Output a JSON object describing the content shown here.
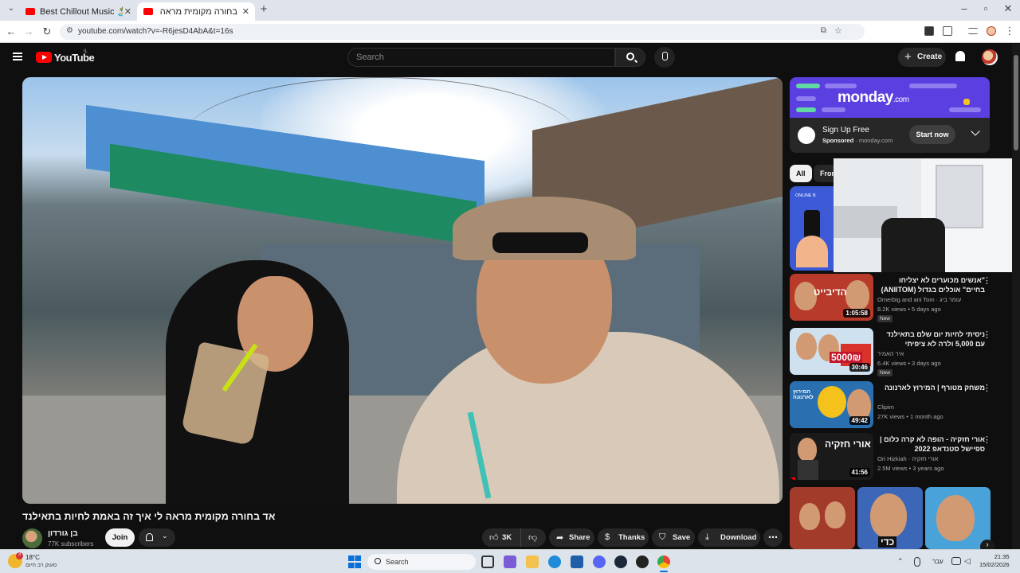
{
  "browser": {
    "tabs": [
      {
        "title": "Best Chillout Music 🏝️ LOUNGE",
        "active": false
      },
      {
        "title": "בחורה מקומית מראה לי איך",
        "active": true
      }
    ],
    "url": "youtube.com/watch?v=-R6jesD4AbA&t=16s"
  },
  "header": {
    "logo": "YouTube",
    "country_code": "IL",
    "search_placeholder": "Search",
    "create_label": "Create"
  },
  "video": {
    "title": "אד בחורה מקומית מראה לי איך זה באמת לחיות בתאילנד",
    "channel_name": "בן גורדון",
    "subscribers": "77K subscribers",
    "join_label": "Join",
    "likes": "3K",
    "share_label": "Share",
    "thanks_label": "Thanks",
    "save_label": "Save",
    "download_label": "Download"
  },
  "ad": {
    "brand": "monday",
    "brand_suffix": ".com",
    "title": "Sign Up Free",
    "sponsored": "Sponsored",
    "domain": "monday.com",
    "cta": "Start now"
  },
  "chips": {
    "all": "All",
    "from": "From"
  },
  "partial_thumb_label": "ONLINE B",
  "recommendations": [
    {
      "title": "\"אנשים מכוערים לא יצליחו בחיים\" אוכלים בגדול (ANIITOM)",
      "channel": "Omerbig and ani Tom · עומר ביג",
      "views": "8.2K views • 5 days ago",
      "badge": "New",
      "duration": "1:05:58",
      "thumb_text": "הדיבייט",
      "thumb_color": "#b83a2a",
      "progress": 0
    },
    {
      "title": "ניסיתי לחיות יום שלם בתאילנד עם 5,000 ולרה לא ציפיתי",
      "channel": "איר האמיר",
      "views": "6.4K views • 3 days ago",
      "badge": "New",
      "duration": "30:46",
      "thumb_text": "5000₪",
      "thumb_color": "#cfe0ef",
      "progress": 0
    },
    {
      "title": "משחק מטורף | המירוץ לארנונה",
      "channel": "Clipim",
      "views": "27K views • 1 month ago",
      "badge": "",
      "duration": "49:42",
      "thumb_text": "המירוץ לארנונה",
      "thumb_color": "#2a6fb0",
      "progress": 0
    },
    {
      "title": "אורי חזקיה - הופה לא קרה כלום | ספיישל סטנדאפ 2022",
      "channel": "Ori Hizkiah · אורי חזקיה",
      "views": "2.5M views • 3 years ago",
      "badge": "",
      "duration": "41:56",
      "thumb_text": "אורי חזקיה",
      "thumb_color": "#1a1a1a",
      "progress": 0.07
    }
  ],
  "shorts": [
    {
      "color": "#a33b2b",
      "text": ""
    },
    {
      "color": "#3c66b8",
      "text": "כדי"
    },
    {
      "color": "#4aa3d8",
      "text": ""
    }
  ],
  "taskbar": {
    "temperature": "18°C",
    "weather": "סעוק רב חיום",
    "weather_badge": "3",
    "search_label": "Search",
    "language": "עבר",
    "time": "21:35",
    "date": "15/02/2026"
  },
  "colors": {
    "yt_background": "#0f0f0f",
    "accent_red": "#ff0000",
    "monday_purple": "#5b3fe0"
  }
}
